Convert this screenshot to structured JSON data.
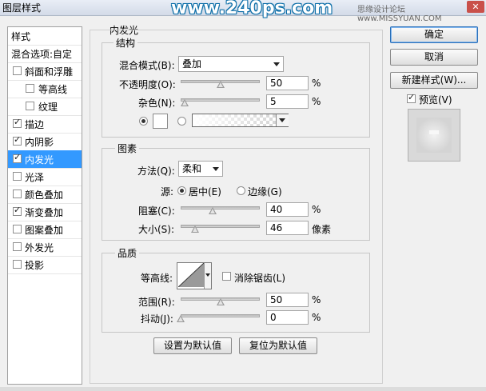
{
  "window": {
    "title": "图层样式",
    "watermark": "www.240ps.com",
    "watermark_small": "思缘设计论坛 www.MISSYUAN.COM",
    "close": "✕"
  },
  "styles_list": {
    "header": "样式",
    "blend_options": "混合选项:自定",
    "items": [
      {
        "label": "斜面和浮雕",
        "checked": false,
        "indent": false,
        "selected": false
      },
      {
        "label": "等高线",
        "checked": false,
        "indent": true,
        "selected": false
      },
      {
        "label": "纹理",
        "checked": false,
        "indent": true,
        "selected": false
      },
      {
        "label": "描边",
        "checked": true,
        "indent": false,
        "selected": false
      },
      {
        "label": "内阴影",
        "checked": true,
        "indent": false,
        "selected": false
      },
      {
        "label": "内发光",
        "checked": true,
        "indent": false,
        "selected": true
      },
      {
        "label": "光泽",
        "checked": false,
        "indent": false,
        "selected": false
      },
      {
        "label": "颜色叠加",
        "checked": false,
        "indent": false,
        "selected": false
      },
      {
        "label": "渐变叠加",
        "checked": true,
        "indent": false,
        "selected": false
      },
      {
        "label": "图案叠加",
        "checked": false,
        "indent": false,
        "selected": false
      },
      {
        "label": "外发光",
        "checked": false,
        "indent": false,
        "selected": false
      },
      {
        "label": "投影",
        "checked": false,
        "indent": false,
        "selected": false
      }
    ]
  },
  "panel": {
    "title": "内发光",
    "structure": {
      "title": "结构",
      "blend_mode_label": "混合模式(B):",
      "blend_mode_value": "叠加",
      "opacity_label": "不透明度(O):",
      "opacity_value": "50",
      "opacity_pct": 0.5,
      "noise_label": "杂色(N):",
      "noise_value": "5",
      "noise_pct": 0.05,
      "unit": "%"
    },
    "elements": {
      "title": "图素",
      "method_label": "方法(Q):",
      "method_value": "柔和",
      "source_label": "源:",
      "source_center": "居中(E)",
      "source_edge": "边缘(G)",
      "choke_label": "阻塞(C):",
      "choke_value": "40",
      "choke_pct": 0.4,
      "size_label": "大小(S):",
      "size_value": "46",
      "size_pct": 0.18,
      "unit_pct": "%",
      "unit_px": "像素"
    },
    "quality": {
      "title": "品质",
      "contour_label": "等高线:",
      "antialias_label": "消除锯齿(L)",
      "range_label": "范围(R):",
      "range_value": "50",
      "range_pct": 0.5,
      "jitter_label": "抖动(J):",
      "jitter_value": "0",
      "jitter_pct": 0.0,
      "unit": "%"
    },
    "set_default": "设置为默认值",
    "reset_default": "复位为默认值"
  },
  "right": {
    "ok": "确定",
    "cancel": "取消",
    "new_style": "新建样式(W)...",
    "preview_label": "预览(V)"
  }
}
